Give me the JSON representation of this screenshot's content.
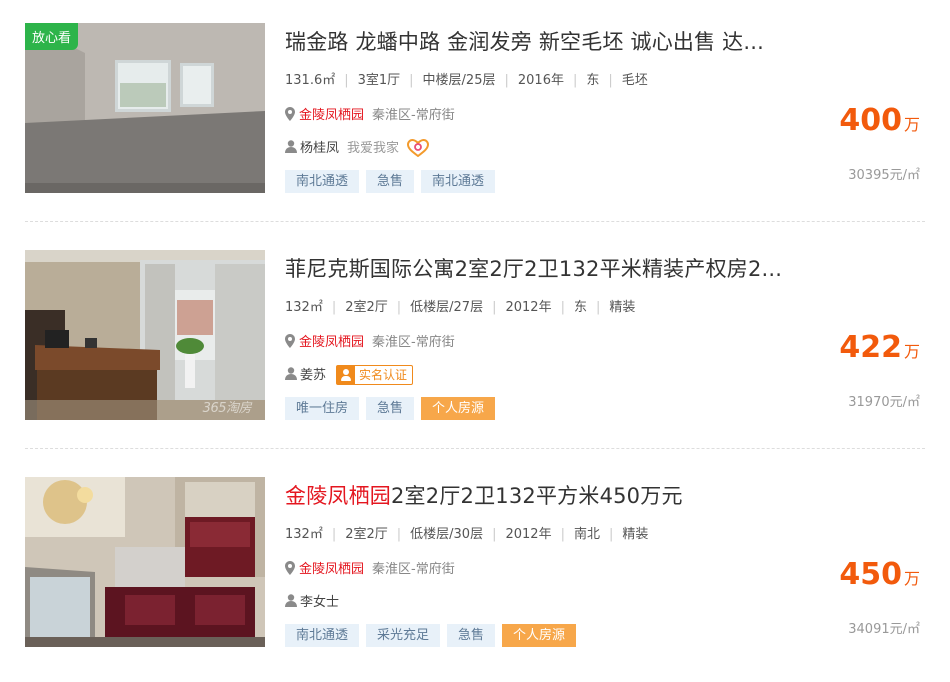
{
  "listings": [
    {
      "badge": "放心看",
      "title": "瑞金路 龙蟠中路 金润发旁 新空毛坯 诚心出售 达...",
      "title_highlight": "",
      "title_rest": "",
      "specs": [
        "131.6㎡",
        "3室1厅",
        "中楼层/25层",
        "2016年",
        "东",
        "毛坯"
      ],
      "community": "金陵凤栖园",
      "district": "秦淮区-常府街",
      "agent": "杨桂凤",
      "company": "我爱我家",
      "verified_label": "",
      "tags": [
        {
          "label": "南北通透",
          "style": "blue"
        },
        {
          "label": "急售",
          "style": "blue"
        },
        {
          "label": "南北通透",
          "style": "blue"
        }
      ],
      "price": "400",
      "price_unit": "万",
      "unit_price": "30395元/㎡",
      "watermark": ""
    },
    {
      "badge": "",
      "title": "菲尼克斯国际公寓2室2厅2卫132平米精装产权房2...",
      "title_highlight": "",
      "title_rest": "",
      "specs": [
        "132㎡",
        "2室2厅",
        "低楼层/27层",
        "2012年",
        "东",
        "精装"
      ],
      "community": "金陵凤栖园",
      "district": "秦淮区-常府街",
      "agent": "姜苏",
      "company": "",
      "verified_label": "实名认证",
      "tags": [
        {
          "label": "唯一住房",
          "style": "blue"
        },
        {
          "label": "急售",
          "style": "blue"
        },
        {
          "label": "个人房源",
          "style": "orange"
        }
      ],
      "price": "422",
      "price_unit": "万",
      "unit_price": "31970元/㎡",
      "watermark": "365淘房"
    },
    {
      "badge": "",
      "title": "",
      "title_highlight": "金陵凤栖园",
      "title_rest": "2室2厅2卫132平方米450万元",
      "specs": [
        "132㎡",
        "2室2厅",
        "低楼层/30层",
        "2012年",
        "南北",
        "精装"
      ],
      "community": "金陵凤栖园",
      "district": "秦淮区-常府街",
      "agent": "李女士",
      "company": "",
      "verified_label": "",
      "tags": [
        {
          "label": "南北通透",
          "style": "blue"
        },
        {
          "label": "采光充足",
          "style": "blue"
        },
        {
          "label": "急售",
          "style": "blue"
        },
        {
          "label": "个人房源",
          "style": "orange"
        }
      ],
      "price": "450",
      "price_unit": "万",
      "unit_price": "34091元/㎡",
      "watermark": ""
    }
  ],
  "icons": {
    "location": "map-pin-icon",
    "agent": "user-icon",
    "company_logo": "heart-logo-icon"
  },
  "colors": {
    "price": "#f25a0c",
    "highlight": "#e4161f",
    "tag_bg": "#e8f1f9",
    "tag_orange": "#f7a74a",
    "badge": "#2db44a"
  }
}
